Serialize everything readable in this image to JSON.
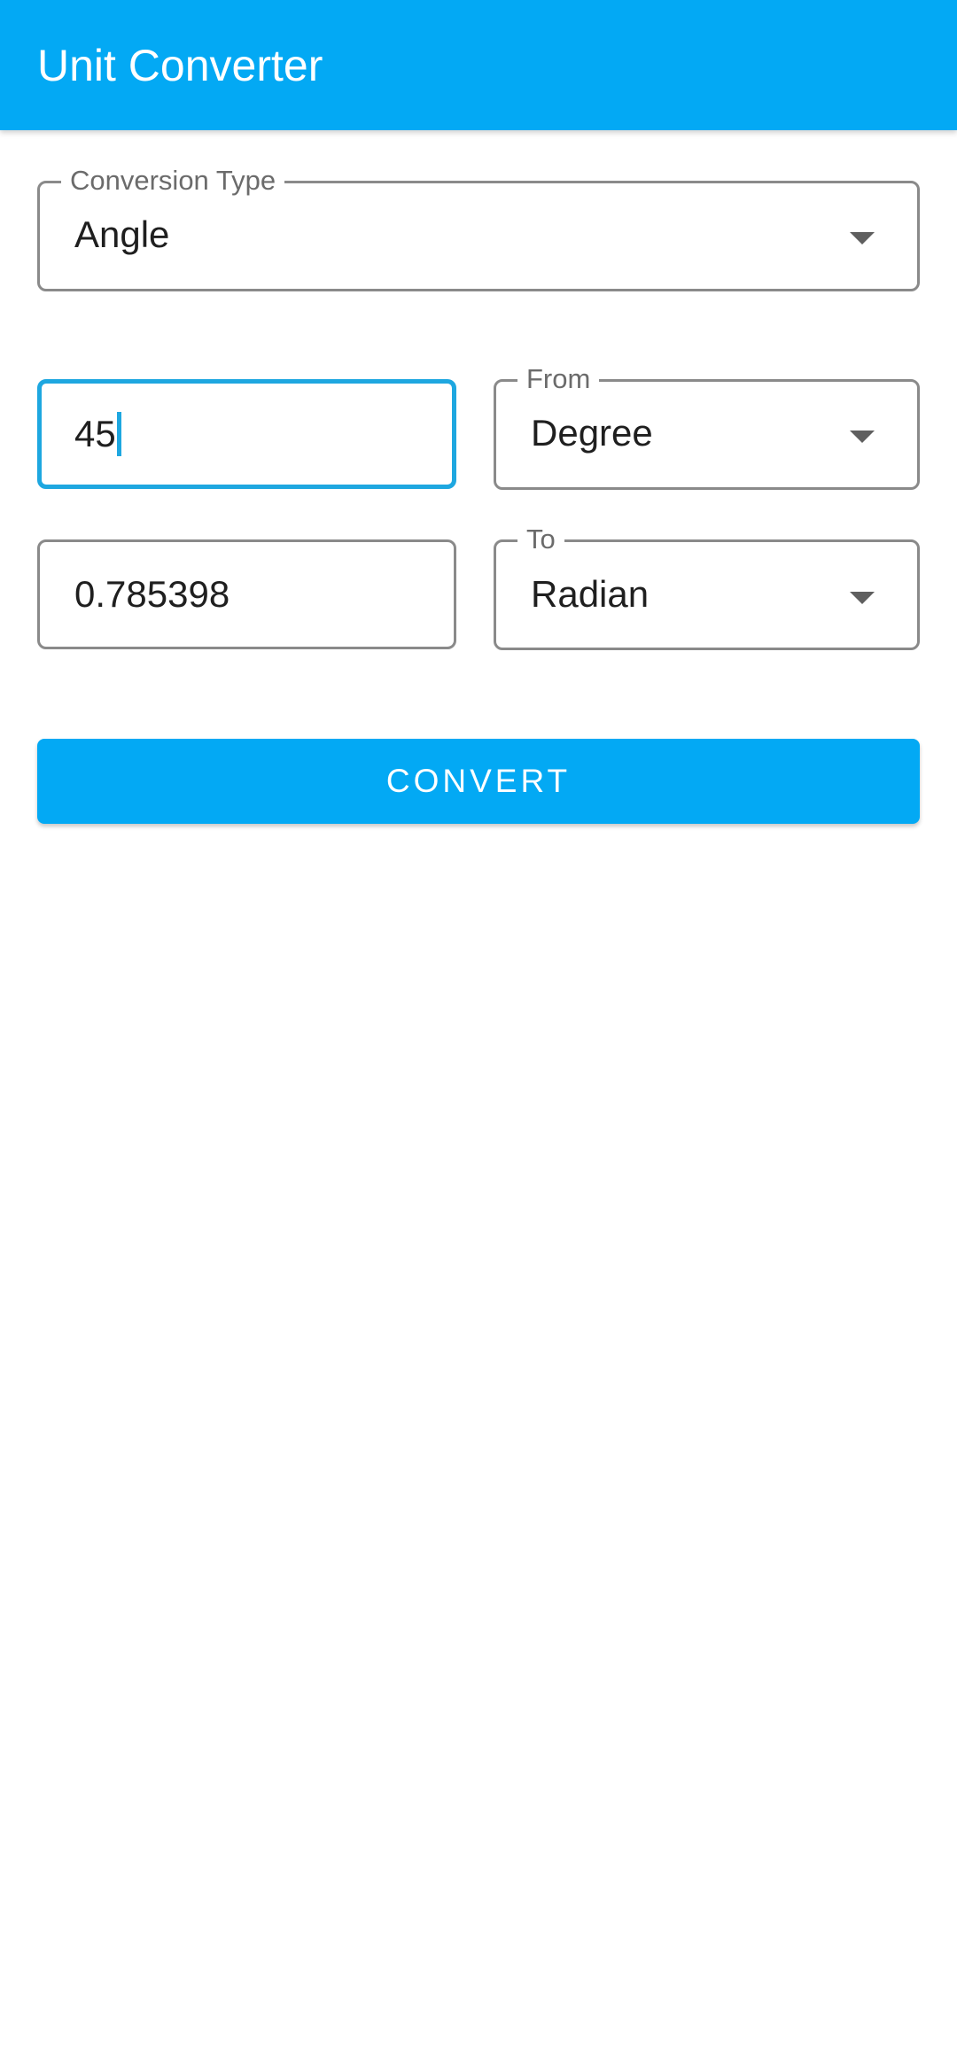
{
  "app_bar": {
    "title": "Unit Converter",
    "color": "#03a9f4"
  },
  "conversion_type": {
    "label": "Conversion Type",
    "value": "Angle"
  },
  "input": {
    "value": "45",
    "focused": true
  },
  "output": {
    "value": "0.785398"
  },
  "from_unit": {
    "label": "From",
    "value": "Degree"
  },
  "to_unit": {
    "label": "To",
    "value": "Radian"
  },
  "convert_button": {
    "label": "CONVERT"
  },
  "icons": {
    "dropdown": "chevron-down-icon"
  }
}
